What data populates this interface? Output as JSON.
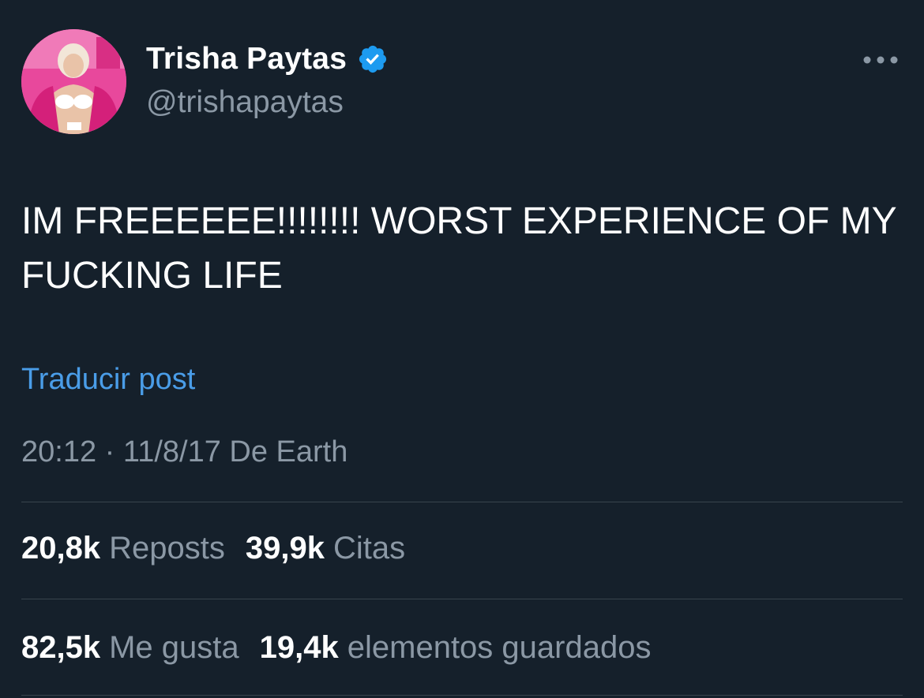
{
  "author": {
    "display_name": "Trisha Paytas",
    "handle": "@trishapaytas",
    "verified": true,
    "avatar": "profile-photo"
  },
  "post": {
    "text_line1": "IM FREEEEEE!!!!!!!! WORST EXPERIENCE OF MY",
    "text_line2": "FUCKING LIFE",
    "translate_label": "Traducir post",
    "time": "20:12",
    "separator": "·",
    "date": "11/8/17",
    "source": "De Earth"
  },
  "stats": {
    "reposts": {
      "count": "20,8k",
      "label": "Reposts"
    },
    "quotes": {
      "count": "39,9k",
      "label": "Citas"
    },
    "likes": {
      "count": "82,5k",
      "label": "Me gusta"
    },
    "bookmarks": {
      "count": "19,4k",
      "label": "elementos guardados"
    }
  },
  "icons": {
    "verified": "verified-badge-icon",
    "more": "more-options-icon"
  },
  "colors": {
    "background": "#15202b",
    "primary_text": "#ffffff",
    "secondary_text": "#8b98a5",
    "link": "#4a9de8",
    "verified_badge": "#1d9bf0",
    "divider": "#38444d"
  }
}
